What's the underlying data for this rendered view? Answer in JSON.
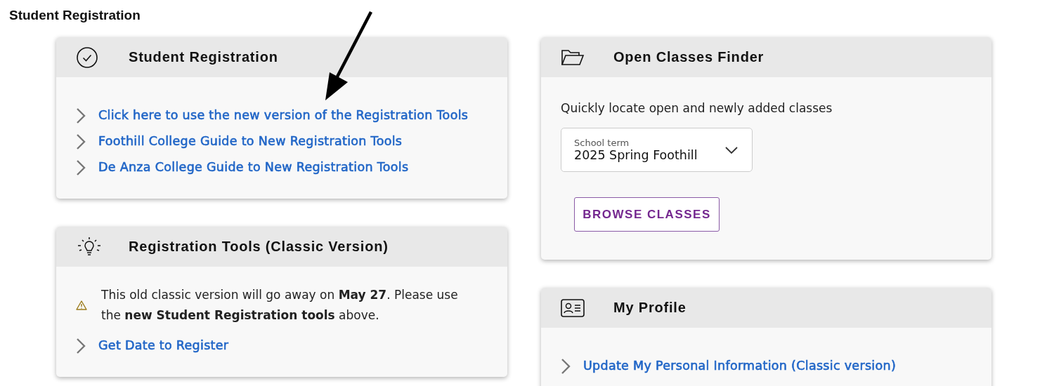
{
  "page_title": "Student Registration",
  "columns": [
    [
      {
        "title": "Student Registration",
        "items": [
          {
            "kind": "link",
            "text": "Click here to use the new version of the Registration Tools"
          },
          {
            "kind": "link",
            "text": "Foothill College Guide to New Registration Tools"
          },
          {
            "kind": "link",
            "text": "De Anza College Guide to New Registration Tools"
          }
        ]
      },
      {
        "title": "Registration Tools (Classic Version)",
        "items": [
          {
            "kind": "notice",
            "text": "This old classic version will go away on **May 27**. Please use the **new Student Registration tools** above."
          },
          {
            "kind": "link",
            "text": "Get Date to Register"
          }
        ]
      }
    ],
    [
      {
        "title": "Open Classes Finder",
        "items": [
          {
            "kind": "text",
            "text": "Quickly locate open and newly added classes"
          },
          {
            "kind": "select",
            "label": "School term",
            "value": "2025 Spring Foothill"
          },
          {
            "kind": "button",
            "text": "BROWSE CLASSES"
          }
        ]
      },
      {
        "title": "My Profile",
        "items": [
          {
            "kind": "link",
            "text": "Update My Personal Information (Classic version)"
          }
        ]
      }
    ]
  ]
}
